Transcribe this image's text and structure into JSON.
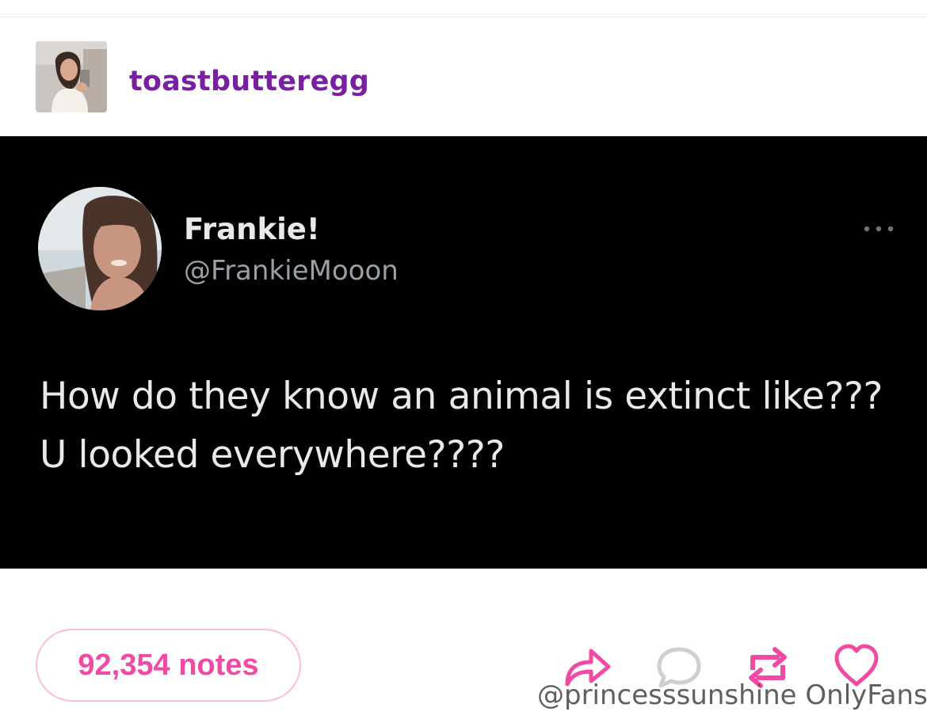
{
  "post": {
    "blog_name": "toastbutteregg",
    "notes_count": "92,354 notes"
  },
  "tweet": {
    "display_name": "Frankie!",
    "handle": "@FrankieMooon",
    "text": "How do they know an animal is extinct like??? U looked everywhere????"
  },
  "actions": [
    {
      "name": "share",
      "icon": "share-arrow-icon"
    },
    {
      "name": "reply",
      "icon": "speech-bubble-icon"
    },
    {
      "name": "reblog",
      "icon": "reblog-icon"
    },
    {
      "name": "like",
      "icon": "heart-icon"
    }
  ],
  "watermark": "@princesssunshine OnlyFans",
  "colors": {
    "blog_name": "#7b1fa2",
    "accent_pink": "#f04aa4",
    "pill_border": "#f9bcdc",
    "tweet_bg": "#000000",
    "tweet_text": "#e7e9ea",
    "tweet_handle": "#9aa0a6"
  }
}
